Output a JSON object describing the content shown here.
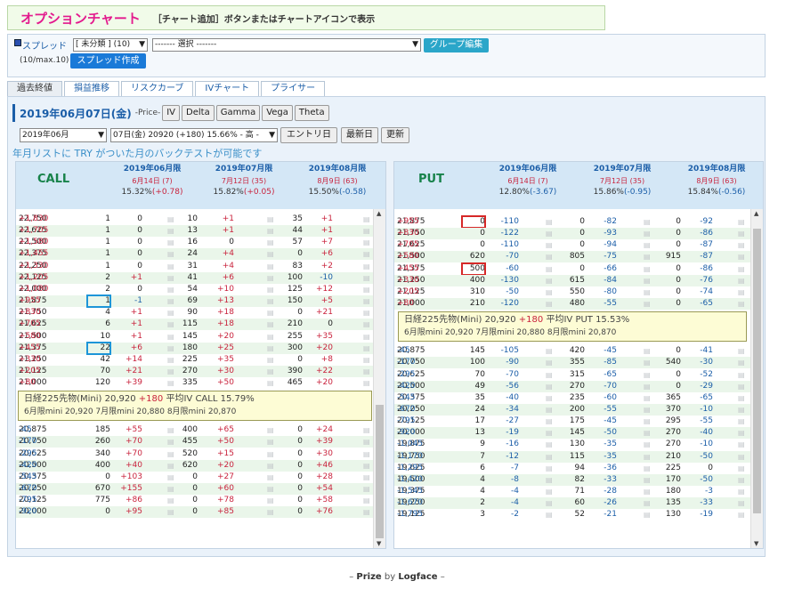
{
  "title": {
    "app": "オプションチャート",
    "hint": "［チャート追加］ボタンまたはチャートアイコンで表示"
  },
  "spread": {
    "label": "スプレッド",
    "category": "[ 未分類 ] (10)",
    "select": "------- 選択 -------",
    "group_btn": "グループ編集",
    "count": "(10/max.10)",
    "create_btn": "スプレッド作成"
  },
  "tabs": [
    "過去終値",
    "損益推移",
    "リスクカーブ",
    "IVチャート",
    "プライサー"
  ],
  "date": {
    "title": "2019年06月07日(金)",
    "price_label": "-Price-",
    "greeks": [
      "IV",
      "Delta",
      "Gamma",
      "Vega",
      "Theta"
    ]
  },
  "controls": {
    "month": "2019年06月",
    "day": "07日(金) 20920 (+180) 15.66% - 高 -",
    "entry": "エントリ日",
    "latest": "最新日",
    "update": "更新"
  },
  "note": "年月リストに TRY がついた月のバックテストが可能です",
  "call": {
    "label": "CALL",
    "months": [
      {
        "m": "2019年06月限",
        "d": "6月14日 (7)",
        "iv": "15.32%",
        "ch": "(+0.78)"
      },
      {
        "m": "2019年07月限",
        "d": "7月12日 (35)",
        "iv": "15.82%",
        "ch": "(+0.05)"
      },
      {
        "m": "2019年08月限",
        "d": "8月9日 (63)",
        "iv": "15.50%",
        "ch": "(-0.58)"
      }
    ],
    "rows_top": [
      [
        "22,750",
        "+1,830",
        "1",
        "0",
        "10",
        "+1",
        "35",
        "+1"
      ],
      [
        "22,625",
        "+1,705",
        "1",
        "0",
        "13",
        "+1",
        "44",
        "+1"
      ],
      [
        "22,500",
        "+1,580",
        "1",
        "0",
        "16",
        "0",
        "57",
        "+7"
      ],
      [
        "22,375",
        "+1,455",
        "1",
        "0",
        "24",
        "+4",
        "0",
        "+6"
      ],
      [
        "22,250",
        "+1,330",
        "1",
        "0",
        "31",
        "+4",
        "83",
        "+2"
      ],
      [
        "22,125",
        "+1,205",
        "2",
        "+1",
        "41",
        "+6",
        "100",
        "-10"
      ],
      [
        "22,000",
        "+1,080",
        "2",
        "0",
        "54",
        "+10",
        "125",
        "+12"
      ],
      [
        "21,875",
        "+955",
        "1",
        "-1",
        "69",
        "+13",
        "150",
        "+5"
      ],
      [
        "21,750",
        "+830",
        "4",
        "+1",
        "90",
        "+18",
        "0",
        "+21"
      ],
      [
        "21,625",
        "+705",
        "6",
        "+1",
        "115",
        "+18",
        "210",
        "0"
      ],
      [
        "21,500",
        "+580",
        "10",
        "+1",
        "145",
        "+20",
        "255",
        "+35"
      ],
      [
        "21,375",
        "+455",
        "22",
        "+6",
        "180",
        "+25",
        "300",
        "+20"
      ],
      [
        "21,250",
        "+330",
        "42",
        "+14",
        "225",
        "+35",
        "0",
        "+8"
      ],
      [
        "21,125",
        "+205",
        "70",
        "+21",
        "270",
        "+30",
        "390",
        "+22"
      ],
      [
        "21,000",
        "+80",
        "120",
        "+39",
        "335",
        "+50",
        "465",
        "+20"
      ]
    ],
    "info": {
      "l1a": "日経225先物(Mini)",
      "l1b": "20,920",
      "l1c": "+180",
      "l1d": "平均IV",
      "l1e": "CALL 15.79%",
      "l2": "6月限mini 20,920 7月限mini 20,880 8月限mini 20,870"
    },
    "rows_bottom": [
      [
        "20,875",
        "-45",
        "185",
        "+55",
        "400",
        "+65",
        "0",
        "+24"
      ],
      [
        "20,750",
        "-170",
        "260",
        "+70",
        "455",
        "+50",
        "0",
        "+39"
      ],
      [
        "20,625",
        "-295",
        "340",
        "+70",
        "520",
        "+15",
        "0",
        "+30"
      ],
      [
        "20,500",
        "-420",
        "400",
        "+40",
        "620",
        "+20",
        "0",
        "+46"
      ],
      [
        "20,375",
        "-545",
        "0",
        "+103",
        "0",
        "+27",
        "0",
        "+28"
      ],
      [
        "20,250",
        "-670",
        "670",
        "+155",
        "0",
        "+60",
        "0",
        "+54"
      ],
      [
        "20,125",
        "-795",
        "775",
        "+86",
        "0",
        "+78",
        "0",
        "+58"
      ],
      [
        "20,000",
        "-920",
        "0",
        "+95",
        "0",
        "+85",
        "0",
        "+76"
      ]
    ]
  },
  "put": {
    "label": "PUT",
    "months": [
      {
        "m": "2019年06月限",
        "d": "6月14日 (7)",
        "iv": "12.80%",
        "ch": "(-3.67)"
      },
      {
        "m": "2019年07月限",
        "d": "7月12日 (35)",
        "iv": "15.86%",
        "ch": "(-0.95)"
      },
      {
        "m": "2019年08月限",
        "d": "8月9日 (63)",
        "iv": "15.84%",
        "ch": "(-0.56)"
      }
    ],
    "rows_top": [
      [
        "21,875",
        "+955",
        "0",
        "-110",
        "0",
        "-82",
        "0",
        "-92"
      ],
      [
        "21,750",
        "+830",
        "0",
        "-122",
        "0",
        "-93",
        "0",
        "-86"
      ],
      [
        "21,625",
        "+705",
        "0",
        "-110",
        "0",
        "-94",
        "0",
        "-87"
      ],
      [
        "21,500",
        "+580",
        "620",
        "-70",
        "805",
        "-75",
        "915",
        "-87"
      ],
      [
        "21,375",
        "+455",
        "500",
        "-60",
        "0",
        "-66",
        "0",
        "-86"
      ],
      [
        "21,250",
        "+330",
        "400",
        "-130",
        "615",
        "-84",
        "0",
        "-76"
      ],
      [
        "21,125",
        "+205",
        "310",
        "-50",
        "550",
        "-80",
        "0",
        "-74"
      ],
      [
        "21,000",
        "+80",
        "210",
        "-120",
        "480",
        "-55",
        "0",
        "-65"
      ]
    ],
    "info": {
      "l1a": "日経225先物(Mini)",
      "l1b": "20,920",
      "l1c": "+180",
      "l1d": "平均IV",
      "l1e": "PUT 15.53%",
      "l2": "6月限mini 20,920 7月限mini 20,880 8月限mini 20,870"
    },
    "rows_bottom": [
      [
        "20,875",
        "-45",
        "145",
        "-105",
        "420",
        "-45",
        "0",
        "-41"
      ],
      [
        "20,750",
        "-170",
        "100",
        "-90",
        "355",
        "-85",
        "540",
        "-30"
      ],
      [
        "20,625",
        "-295",
        "70",
        "-70",
        "315",
        "-65",
        "0",
        "-52"
      ],
      [
        "20,500",
        "-420",
        "49",
        "-56",
        "270",
        "-70",
        "0",
        "-29"
      ],
      [
        "20,375",
        "-545",
        "35",
        "-40",
        "235",
        "-60",
        "365",
        "-65"
      ],
      [
        "20,250",
        "-670",
        "24",
        "-34",
        "200",
        "-55",
        "370",
        "-10"
      ],
      [
        "20,125",
        "-795",
        "17",
        "-27",
        "175",
        "-45",
        "295",
        "-55"
      ],
      [
        "20,000",
        "-920",
        "13",
        "-19",
        "145",
        "-50",
        "270",
        "-40"
      ],
      [
        "19,875",
        "-1,045",
        "9",
        "-16",
        "130",
        "-35",
        "270",
        "-10"
      ],
      [
        "19,750",
        "-1,170",
        "7",
        "-12",
        "115",
        "-35",
        "210",
        "-50"
      ],
      [
        "19,625",
        "-1,295",
        "6",
        "-7",
        "94",
        "-36",
        "225",
        "0"
      ],
      [
        "19,500",
        "-1,420",
        "4",
        "-8",
        "82",
        "-33",
        "170",
        "-50"
      ],
      [
        "19,375",
        "-1,545",
        "4",
        "-4",
        "71",
        "-28",
        "180",
        "-3"
      ],
      [
        "19,250",
        "-1,670",
        "2",
        "-4",
        "60",
        "-26",
        "135",
        "-33"
      ],
      [
        "19,125",
        "-1,795",
        "3",
        "-2",
        "52",
        "-21",
        "130",
        "-19"
      ]
    ]
  },
  "footer": {
    "a": "Prize",
    "b": "by",
    "c": "Logface"
  },
  "colors": {
    "accent": "#e3198d",
    "link": "#1b5ea8",
    "positive": "#c9233d",
    "negative": "#1b5ea8",
    "row_alt": "#eaf6ea",
    "info_bg": "#fdfcd5"
  }
}
